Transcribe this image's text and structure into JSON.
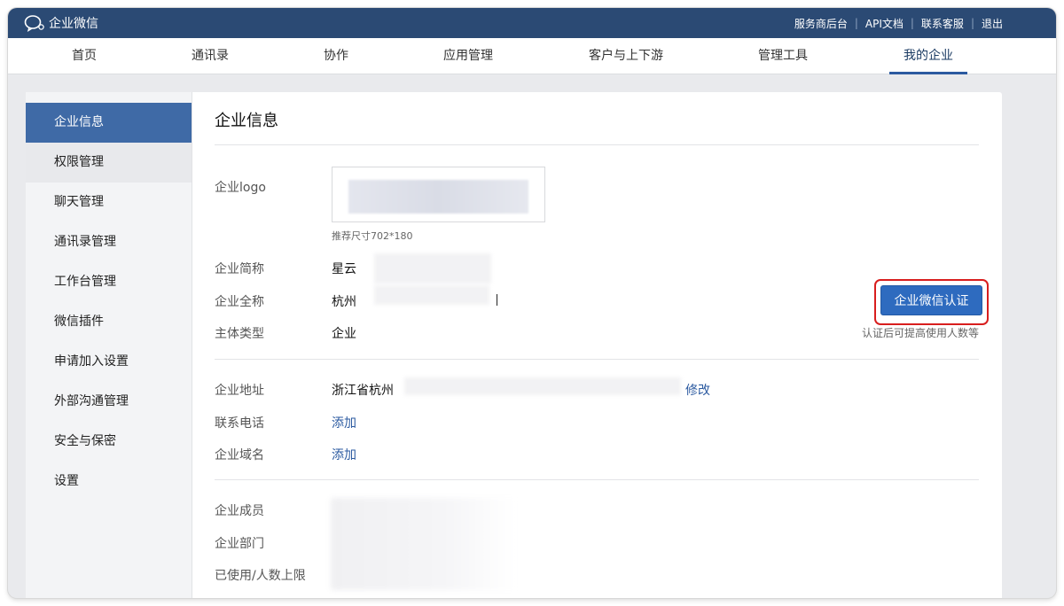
{
  "app": {
    "title": "企业微信"
  },
  "top_links": [
    "服务商后台",
    "API文档",
    "联系客服",
    "退出"
  ],
  "nav": {
    "items": [
      "首页",
      "通讯录",
      "协作",
      "应用管理",
      "客户与上下游",
      "管理工具",
      "我的企业"
    ],
    "active": "我的企业"
  },
  "sidebar": {
    "items": [
      "企业信息",
      "权限管理",
      "聊天管理",
      "通讯录管理",
      "工作台管理",
      "微信插件",
      "申请加入设置",
      "外部沟通管理",
      "安全与保密",
      "设置"
    ],
    "active": "企业信息"
  },
  "main": {
    "title": "企业信息",
    "logo_label": "企业logo",
    "logo_hint": "推荐尺寸702*180",
    "short_name_label": "企业简称",
    "short_name_value": "星云",
    "full_name_label": "企业全称",
    "full_name_value": "杭州",
    "type_label": "主体类型",
    "type_value": "企业",
    "certify_button": "企业微信认证",
    "certify_note": "认证后可提高使用人数等",
    "address_label": "企业地址",
    "address_value": "浙江省杭州",
    "address_edit": "修改",
    "phone_label": "联系电话",
    "phone_add": "添加",
    "domain_label": "企业域名",
    "domain_add": "添加",
    "members_label": "企业成员",
    "departments_label": "企业部门",
    "limit_label": "已使用/人数上限"
  },
  "colors": {
    "topbar": "#2b4a74",
    "accent": "#2e6bbf",
    "sidebar_active": "#3f6aa6",
    "highlight_border": "#d81e1e"
  }
}
